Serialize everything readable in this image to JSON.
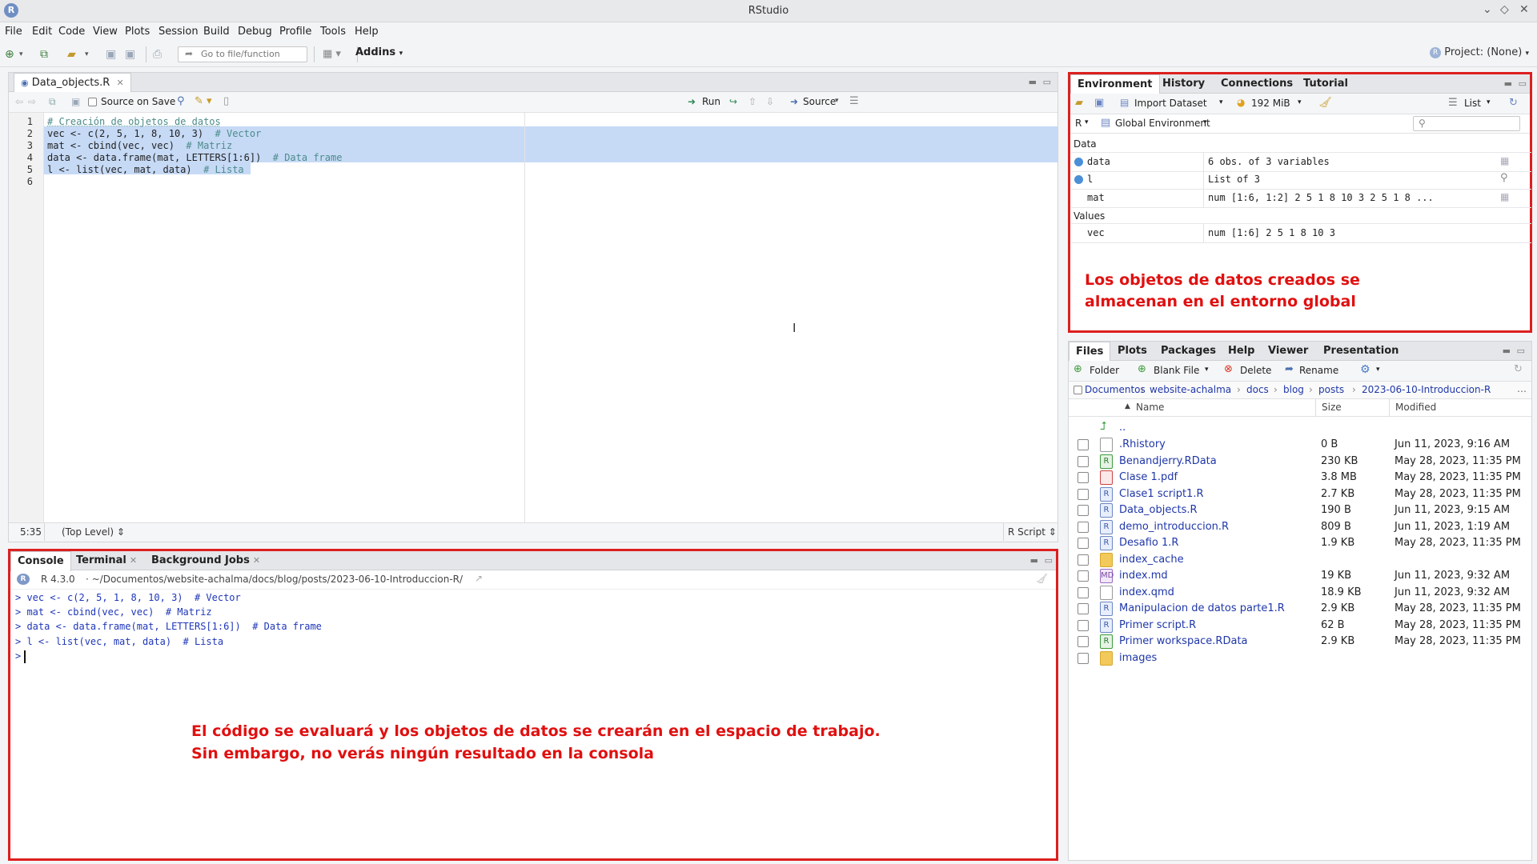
{
  "window": {
    "title": "RStudio",
    "controls": [
      "⌄",
      "◇",
      "✕"
    ]
  },
  "menu": [
    "File",
    "Edit",
    "Code",
    "View",
    "Plots",
    "Session",
    "Build",
    "Debug",
    "Profile",
    "Tools",
    "Help"
  ],
  "toolbar": {
    "goto_placeholder": "Go to file/function",
    "addins_label": "Addins",
    "project_label": "Project: (None)"
  },
  "editor": {
    "tab_label": "Data_objects.R",
    "source_on_save": "Source on Save",
    "run_label": "Run",
    "source_label": "Source",
    "lines": [
      {
        "n": "1",
        "comment": "# Creación de objetos de datos",
        "code": ""
      },
      {
        "n": "2",
        "code": "vec <- c(2, 5, 1, 8, 10, 3)",
        "comment": "  # Vector"
      },
      {
        "n": "3",
        "code": "mat <- cbind(vec, vec)",
        "comment": "  # Matriz"
      },
      {
        "n": "4",
        "code": "data <- data.frame(mat, LETTERS[1:6])",
        "comment": "  # Data frame"
      },
      {
        "n": "5",
        "code": "l <- list(vec, mat, data)",
        "comment": "  # Lista"
      },
      {
        "n": "6",
        "code": "",
        "comment": ""
      }
    ],
    "status_position": "5:35",
    "status_scope": "(Top Level) ⇕",
    "status_type": "R Script ⇕"
  },
  "console": {
    "tabs": [
      "Console",
      "Terminal",
      "Background Jobs"
    ],
    "r_version": "R 4.3.0",
    "path": "· ~/Documentos/website-achalma/docs/blog/posts/2023-06-10-Introduccion-R/",
    "lines": [
      "> vec <- c(2, 5, 1, 8, 10, 3)  # Vector",
      "> mat <- cbind(vec, vec)  # Matriz",
      "> data <- data.frame(mat, LETTERS[1:6])  # Data frame",
      "> l <- list(vec, mat, data)  # Lista",
      "> "
    ],
    "annotation_line1": "El código se evaluará y los objetos de datos se crearán en el espacio de trabajo.",
    "annotation_line2": "Sin embargo, no verás ningún resultado en la consola"
  },
  "environment": {
    "tabs": [
      "Environment",
      "History",
      "Connections",
      "Tutorial"
    ],
    "import_label": "Import Dataset",
    "memory_label": "192 MiB",
    "list_label": "List",
    "lang_label": "R",
    "scope_label": "Global Environment",
    "section_data": "Data",
    "section_values": "Values",
    "rows_data": [
      {
        "name": "data",
        "value": "6 obs. of 3 variables"
      },
      {
        "name": "l",
        "value": "List of  3"
      },
      {
        "name": "mat",
        "value": "num [1:6, 1:2] 2 5 1 8 10 3 2 5 1 8 ..."
      }
    ],
    "rows_values": [
      {
        "name": "vec",
        "value": "num [1:6] 2 5 1 8 10 3"
      }
    ],
    "annotation_line1": "Los objetos de datos creados se",
    "annotation_line2": "almacenan en el entorno global"
  },
  "files": {
    "tabs": [
      "Files",
      "Plots",
      "Packages",
      "Help",
      "Viewer",
      "Presentation"
    ],
    "folder_label": "Folder",
    "blank_file_label": "Blank File",
    "delete_label": "Delete",
    "rename_label": "Rename",
    "breadcrumb": [
      "Documentos",
      "website-achalma",
      "docs",
      "blog",
      "posts",
      "2023-06-10-Introduccion-R"
    ],
    "col_name": "Name",
    "col_size": "Size",
    "col_modified": "Modified",
    "up_label": "..",
    "rows": [
      {
        "name": ".Rhistory",
        "size": "0 B",
        "modified": "Jun 11, 2023, 9:16 AM",
        "icon": "doc"
      },
      {
        "name": "Benandjerry.RData",
        "size": "230 KB",
        "modified": "May 28, 2023, 11:35 PM",
        "icon": "rdata"
      },
      {
        "name": "Clase 1.pdf",
        "size": "3.8 MB",
        "modified": "May 28, 2023, 11:35 PM",
        "icon": "pdf"
      },
      {
        "name": "Clase1 script1.R",
        "size": "2.7 KB",
        "modified": "May 28, 2023, 11:35 PM",
        "icon": "r"
      },
      {
        "name": "Data_objects.R",
        "size": "190 B",
        "modified": "Jun 11, 2023, 9:15 AM",
        "icon": "r"
      },
      {
        "name": "demo_introduccion.R",
        "size": "809 B",
        "modified": "Jun 11, 2023, 1:19 AM",
        "icon": "r"
      },
      {
        "name": "Desafio 1.R",
        "size": "1.9 KB",
        "modified": "May 28, 2023, 11:35 PM",
        "icon": "r"
      },
      {
        "name": "index_cache",
        "size": "",
        "modified": "",
        "icon": "folder"
      },
      {
        "name": "index.md",
        "size": "19 KB",
        "modified": "Jun 11, 2023, 9:32 AM",
        "icon": "md"
      },
      {
        "name": "index.qmd",
        "size": "18.9 KB",
        "modified": "Jun 11, 2023, 9:32 AM",
        "icon": "doc"
      },
      {
        "name": "Manipulacion de datos parte1.R",
        "size": "2.9 KB",
        "modified": "May 28, 2023, 11:35 PM",
        "icon": "r"
      },
      {
        "name": "Primer script.R",
        "size": "62 B",
        "modified": "May 28, 2023, 11:35 PM",
        "icon": "r"
      },
      {
        "name": "Primer workspace.RData",
        "size": "2.9 KB",
        "modified": "May 28, 2023, 11:35 PM",
        "icon": "rdata"
      },
      {
        "name": "images",
        "size": "",
        "modified": "",
        "icon": "folder"
      }
    ]
  },
  "colors": {
    "highlight": "#dd1f1f",
    "selection": "#c6daf6",
    "link": "#1f37a8"
  }
}
